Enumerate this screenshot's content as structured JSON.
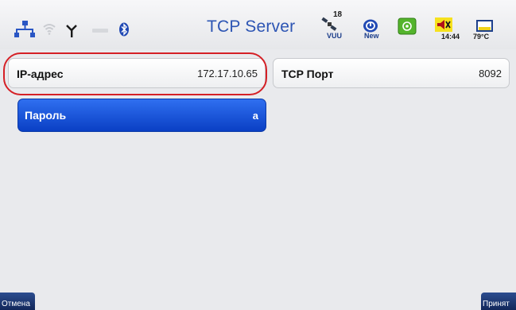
{
  "status_bar": {
    "title": "TCP Server",
    "satellite_count": "18",
    "vuu_label": "VUU",
    "new_label": "New",
    "time": "14:44",
    "temperature": "79°C",
    "icons": [
      "network-icon",
      "wifi-icon",
      "antenna-icon",
      "signal-icon",
      "bluetooth-icon",
      "satellite-icon",
      "update-icon",
      "gps-icon",
      "alarm-icon",
      "battery-icon"
    ]
  },
  "fields": {
    "ip": {
      "label": "IP-адрес",
      "value": "172.17.10.65"
    },
    "port": {
      "label": "TCP Порт",
      "value": "8092"
    },
    "password": {
      "label": "Пароль",
      "value": "a"
    }
  },
  "buttons": {
    "cancel": "Отмена",
    "accept": "Принят"
  },
  "colors": {
    "accent": "#2d55b4",
    "selected_field": "#1a52d9",
    "highlight": "#d52026"
  }
}
